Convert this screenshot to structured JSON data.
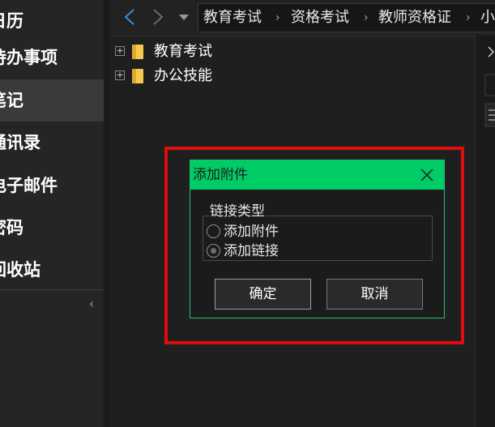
{
  "sidebar": {
    "items": [
      {
        "label": "日历",
        "active": false
      },
      {
        "label": "待办事项",
        "active": false
      },
      {
        "label": "笔记",
        "active": true
      },
      {
        "label": "通讯录",
        "active": false
      },
      {
        "label": "电子邮件",
        "active": false
      },
      {
        "label": "密码",
        "active": false
      },
      {
        "label": "回收站",
        "active": false
      }
    ],
    "collapse_glyph": "‹"
  },
  "breadcrumb": {
    "items": [
      "教育考试",
      "资格考试",
      "教师资格证",
      "小"
    ]
  },
  "tree": {
    "items": [
      {
        "label": "教育考试"
      },
      {
        "label": "办公技能"
      }
    ]
  },
  "dialog": {
    "title": "添加附件",
    "group_label": "链接类型",
    "options": [
      {
        "label": "添加附件",
        "selected": false
      },
      {
        "label": "添加链接",
        "selected": true
      }
    ],
    "ok_label": "确定",
    "cancel_label": "取消"
  },
  "colors": {
    "title_bar": "#00cc66",
    "highlight": "#e00d0d",
    "nav_back": "#2f8fe8"
  }
}
